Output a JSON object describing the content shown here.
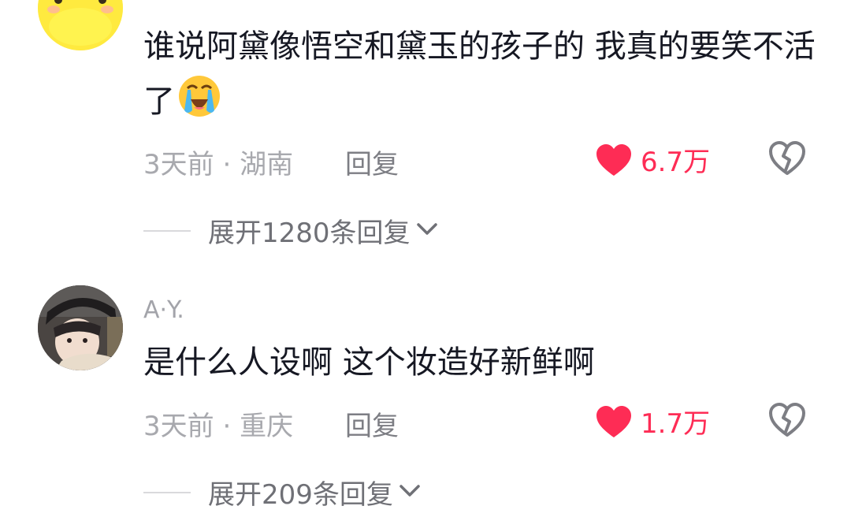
{
  "comments": [
    {
      "username": "",
      "text": "谁说阿黛像悟空和黛玉的孩子的 我真的要笑不活了",
      "emoji": "loudly-crying-face",
      "time": "3天前",
      "separator": "·",
      "location": "湖南",
      "reply_label": "回复",
      "likes": "6.7万",
      "expand_label": "展开1280条回复"
    },
    {
      "username": "A·Y.",
      "text": "是什么人设啊 这个妆造好新鲜啊",
      "time": "3天前",
      "separator": "·",
      "location": "重庆",
      "reply_label": "回复",
      "likes": "1.7万",
      "expand_label": "展开209条回复"
    }
  ],
  "colors": {
    "like_red": "#fe2c55",
    "meta_gray": "#a8a9ae",
    "text_dark": "#161823"
  },
  "icons": [
    "heart-icon",
    "broken-heart-icon",
    "chevron-down-icon",
    "duck-avatar-icon",
    "loudly-crying-face-emoji"
  ]
}
